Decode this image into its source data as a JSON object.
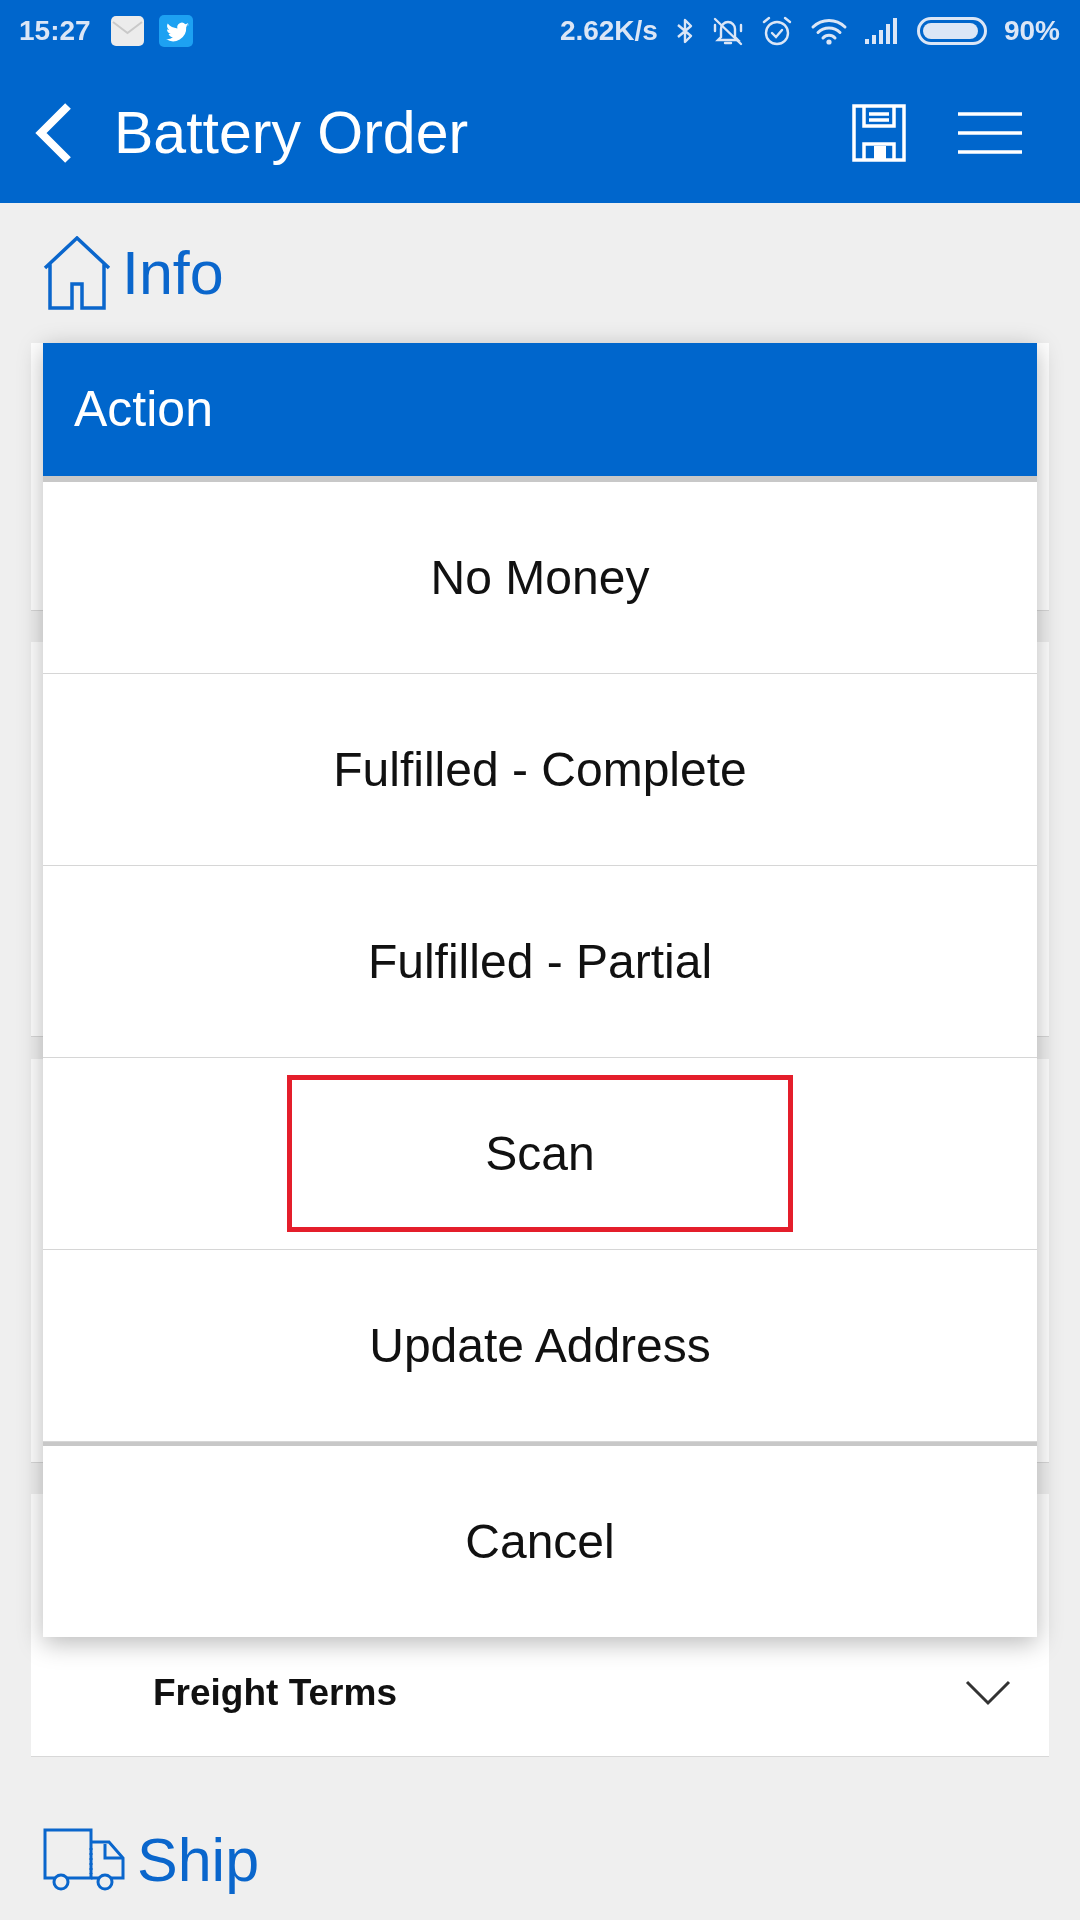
{
  "status_bar": {
    "time": "15:27",
    "network_speed": "2.62K/s",
    "battery": "90%"
  },
  "app_bar": {
    "title": "Battery Order"
  },
  "info_section": {
    "title": "Info",
    "fields": [
      {
        "label": "Freight Terms",
        "expanded": false
      }
    ]
  },
  "action_dialog": {
    "title": "Action",
    "options": [
      {
        "label": "No Money",
        "highlighted": false
      },
      {
        "label": "Fulfilled - Complete",
        "highlighted": false
      },
      {
        "label": "Fulfilled - Partial",
        "highlighted": false
      },
      {
        "label": "Scan",
        "highlighted": true
      },
      {
        "label": "Update Address",
        "highlighted": false
      }
    ],
    "cancel": "Cancel"
  },
  "ship_section": {
    "title": "Ship"
  }
}
